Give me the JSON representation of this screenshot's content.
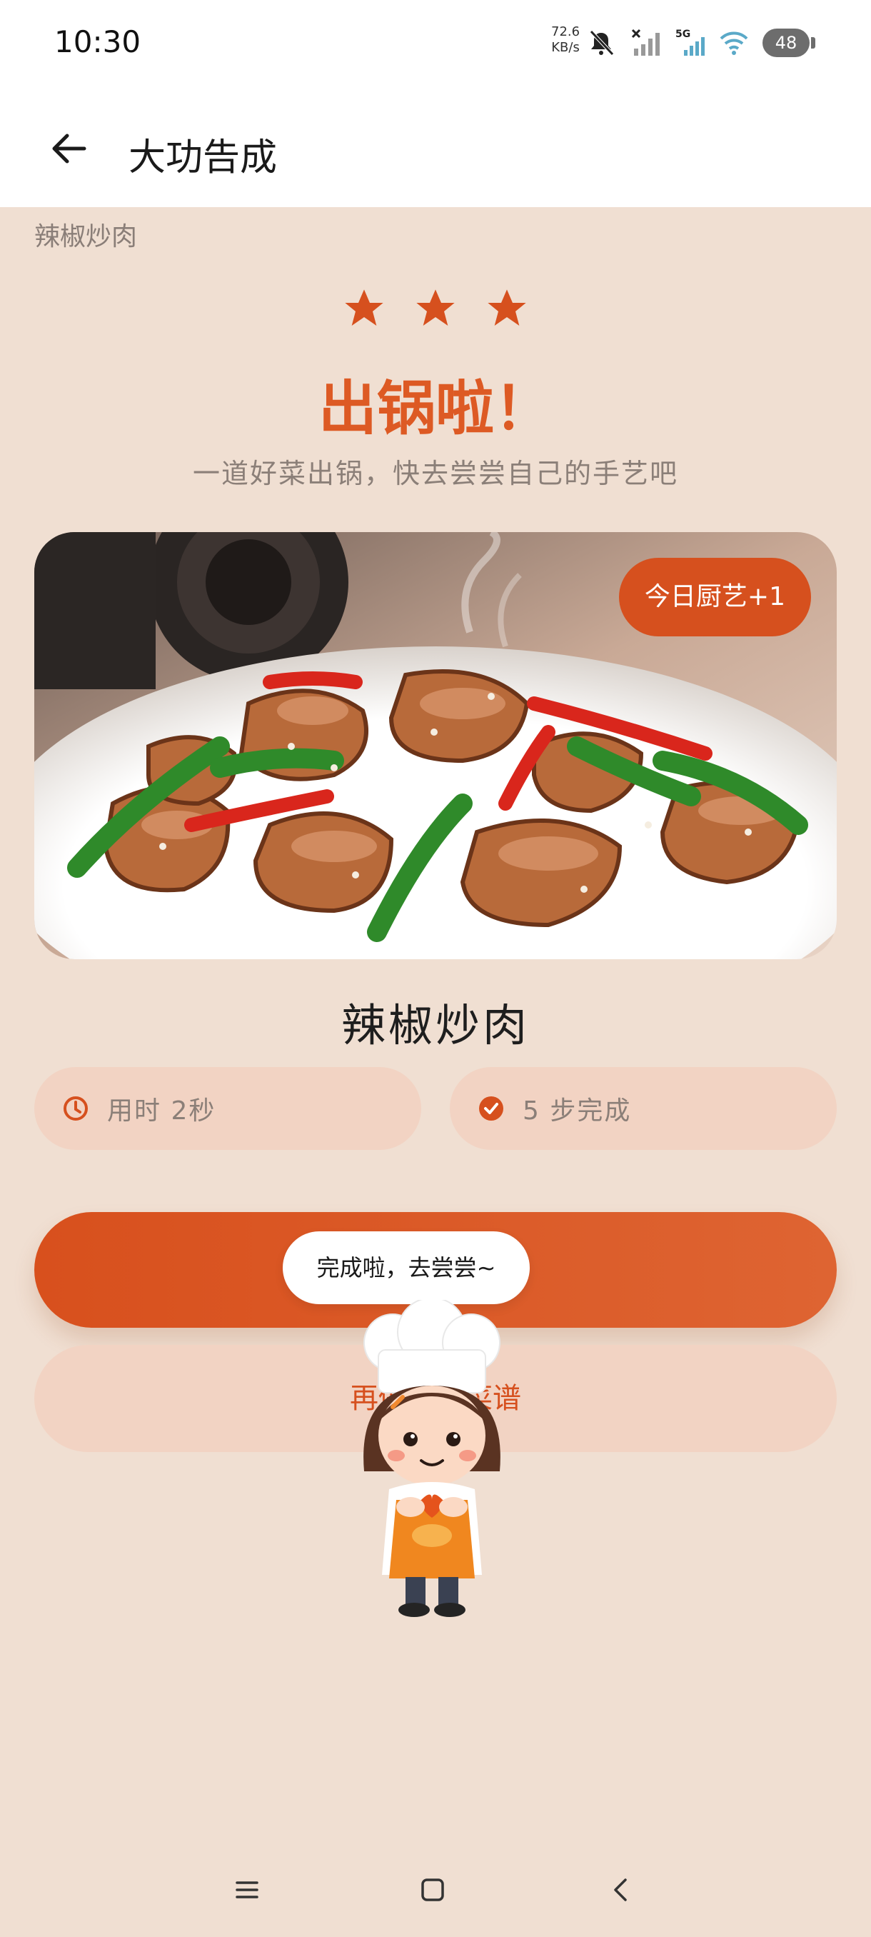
{
  "status_bar": {
    "time": "10:30",
    "net_speed_value": "72.6",
    "net_speed_unit": "KB/s",
    "network": "5G",
    "battery": "48",
    "icons": [
      "bell-muted-icon",
      "signal-off-icon",
      "signal-5g-icon",
      "wifi-icon",
      "battery-icon"
    ]
  },
  "header": {
    "back_icon": "arrow-left-icon",
    "title": "大功告成"
  },
  "recipe_label": "辣椒炒肉",
  "rating": {
    "stars": 3
  },
  "headline": "出锅啦！",
  "tagline": "一道好菜出锅，快去尝尝自己的手艺吧",
  "food_image": {
    "badge": "今日厨艺+1"
  },
  "dish_name": "辣椒炒肉",
  "stats": {
    "time_text": "用时 2秒",
    "time_icon": "clock-icon",
    "steps_text": "5 步完成",
    "steps_icon": "check-circle-icon"
  },
  "buttons": {
    "primary_label": "",
    "secondary_label": "再做一道菜谱"
  },
  "mascot": {
    "speech": "完成啦，去尝尝~"
  },
  "nav": {
    "items": [
      "menu-icon",
      "home-icon",
      "back-icon"
    ]
  },
  "colors": {
    "accent": "#D6501E",
    "background": "#F0DFD2",
    "pill": "#F2D3C3"
  }
}
